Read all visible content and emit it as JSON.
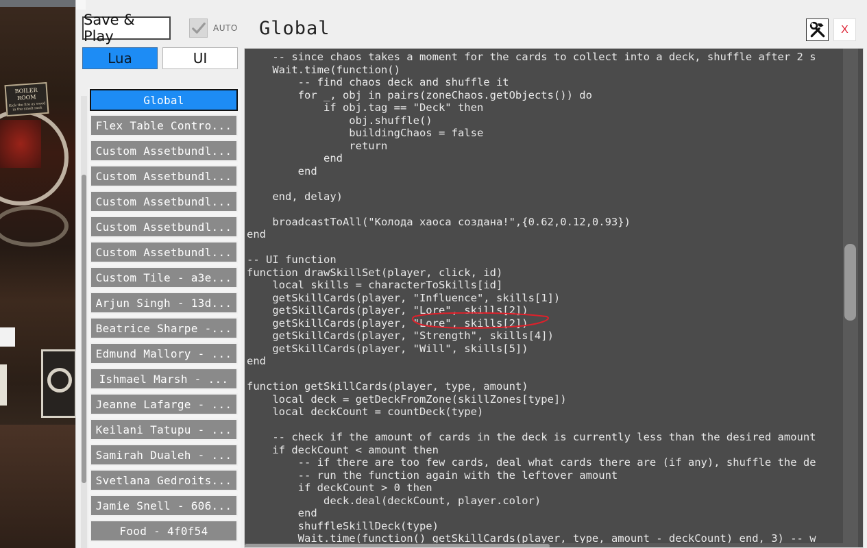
{
  "background": {
    "card_title": "BOILER",
    "card_subtitle": "ROOM",
    "card_text": "Kick the fire as wood in the smelt rack"
  },
  "header": {
    "save_play_label": "Save & Play",
    "auto_label": "AUTO",
    "auto_checked": true,
    "title": "Global",
    "tools_icon": "hammer-wrench-icon",
    "close_label": "X"
  },
  "tabs": {
    "lua_label": "Lua",
    "ui_label": "UI",
    "active": "Lua"
  },
  "script_list": {
    "items": [
      {
        "label": "Global",
        "active": true
      },
      {
        "label": "Flex Table Contro..."
      },
      {
        "label": "Custom Assetbundl..."
      },
      {
        "label": "Custom Assetbundl..."
      },
      {
        "label": "Custom Assetbundl..."
      },
      {
        "label": "Custom Assetbundl..."
      },
      {
        "label": "Custom Assetbundl..."
      },
      {
        "label": "Custom Tile - a3e..."
      },
      {
        "label": "Arjun Singh - 13d..."
      },
      {
        "label": "Beatrice Sharpe -..."
      },
      {
        "label": "Edmund Mallory - ..."
      },
      {
        "label": "Ishmael Marsh - ..."
      },
      {
        "label": "Jeanne Lafarge - ..."
      },
      {
        "label": "Keilani Tatupu - ..."
      },
      {
        "label": "Samirah Dualeh - ..."
      },
      {
        "label": "Svetlana Gedroits..."
      },
      {
        "label": "Jamie Snell - 606..."
      },
      {
        "label": "Food - 4f0f54"
      }
    ]
  },
  "editor": {
    "lines": [
      "    -- since chaos takes a moment for the cards to collect into a deck, shuffle after 2 s",
      "    Wait.time(function()",
      "        -- find chaos deck and shuffle it",
      "        for _, obj in pairs(zoneChaos.getObjects()) do",
      "            if obj.tag == \"Deck\" then",
      "                obj.shuffle()",
      "                buildingChaos = false",
      "                return",
      "            end",
      "        end",
      "",
      "    end, delay)",
      "",
      "    broadcastToAll(\"Колода хаоса создана!\",{0.62,0.12,0.93})",
      "end",
      "",
      "-- UI function",
      "function drawSkillSet(player, click, id)",
      "    local skills = characterToSkills[id]",
      "    getSkillCards(player, \"Influence\", skills[1])",
      "    getSkillCards(player, \"Lore\", skills[2])",
      "    getSkillCards(player, \"Lore\", skills[2])",
      "    getSkillCards(player, \"Strength\", skills[4])",
      "    getSkillCards(player, \"Will\", skills[5])",
      "end",
      "",
      "function getSkillCards(player, type, amount)",
      "    local deck = getDeckFromZone(skillZones[type])",
      "    local deckCount = countDeck(type)",
      "",
      "    -- check if the amount of cards in the deck is currently less than the desired amount",
      "    if deckCount < amount then",
      "        -- if there are too few cards, deal what cards there are (if any), shuffle the de",
      "        -- run the function again with the leftover amount",
      "        if deckCount > 0 then",
      "            deck.deal(deckCount, player.color)",
      "        end",
      "        shuffleSkillDeck(type)",
      "        Wait.time(function() getSkillCards(player, type, amount - deckCount) end, 3) -- w"
    ],
    "annotation_color": "#e0202a"
  },
  "colors": {
    "accent": "#1d8cf5",
    "editor_bg": "#4b4b4b",
    "list_item_bg": "#8a8a8a",
    "close_x": "#dd2233"
  }
}
